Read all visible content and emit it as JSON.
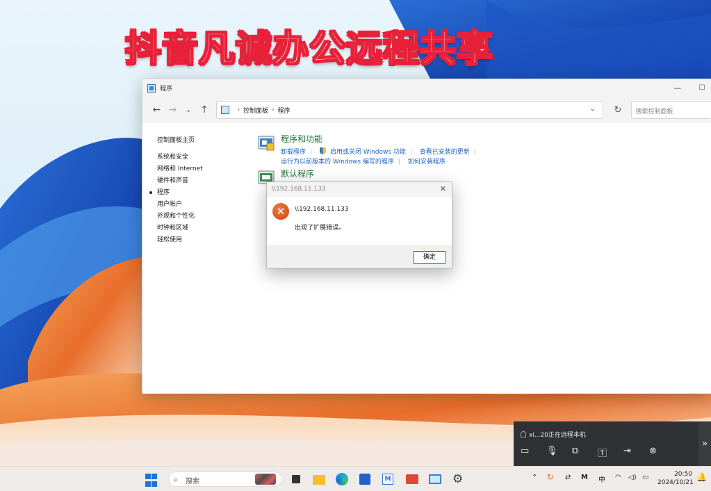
{
  "overlay": {
    "title": "抖音凡诚办公远程共享"
  },
  "window": {
    "title": "程序",
    "address": {
      "crumbs": [
        "控制面板",
        "程序"
      ]
    },
    "search_placeholder": "搜索控制面板",
    "sidebar": {
      "home": "控制面板主页",
      "items": [
        "系统和安全",
        "网络和 Internet",
        "硬件和声音",
        "程序",
        "用户帐户",
        "外观和个性化",
        "时钟和区域",
        "轻松使用"
      ],
      "active_index": 3
    },
    "categories": [
      {
        "title": "程序和功能",
        "links_row1": [
          "卸载程序",
          "启用或关闭 Windows 功能",
          "查看已安装的更新"
        ],
        "links_row2": [
          "运行为以前版本的 Windows 编写的程序",
          "如何安装程序"
        ]
      },
      {
        "title": "默认程序"
      }
    ]
  },
  "dialog": {
    "title": "\\\\192.168.11.133",
    "heading": "\\\\192.168.11.133",
    "message": "出现了扩展错误。",
    "ok_label": "确定"
  },
  "remote": {
    "status": "xi...20正在远程本机",
    "icons": [
      "chat-icon",
      "microphone-icon",
      "remote-screen-icon",
      "text-icon",
      "file-transfer-icon",
      "disconnect-icon"
    ]
  },
  "taskbar": {
    "search_label": "搜索",
    "ime": "中",
    "time": "20:50",
    "date": "2024/10/21"
  },
  "colors": {
    "accent": "#1f74d6",
    "link": "#1e64c8",
    "category_title": "#1a7334",
    "overlay_stroke": "#e8213a",
    "error_icon": "#d9541a"
  }
}
